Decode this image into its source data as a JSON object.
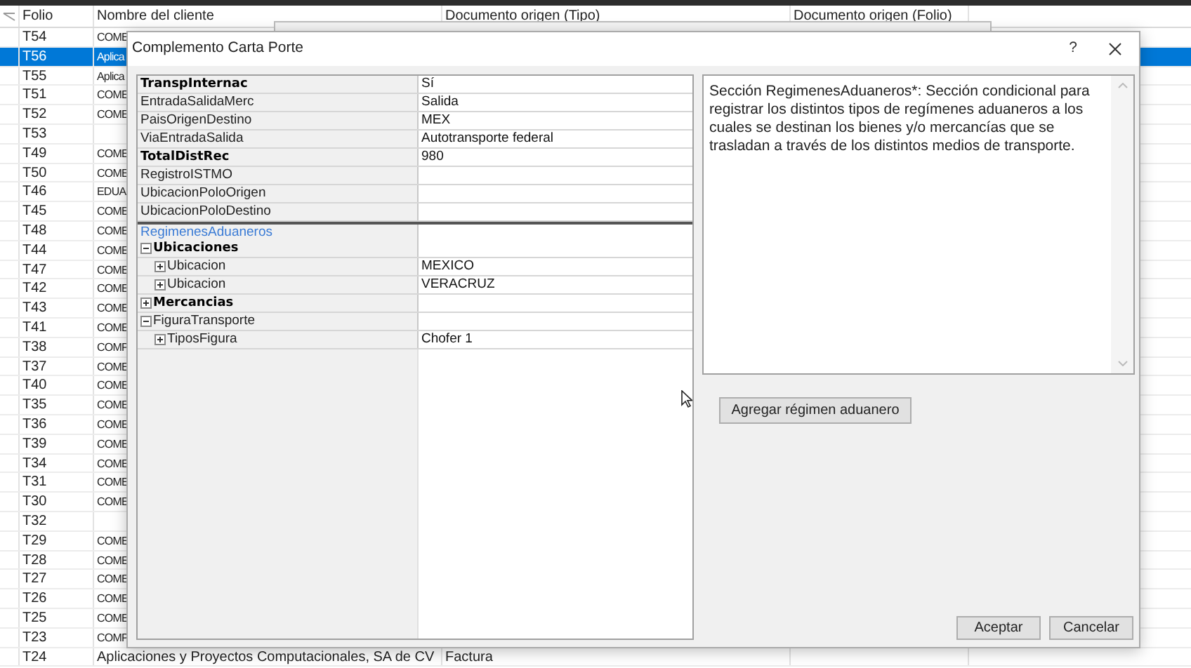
{
  "table": {
    "columns": [
      "Folio",
      "Nombre del cliente",
      "Documento origen (Tipo)",
      "Documento origen (Folio)"
    ],
    "rows": [
      {
        "folio": "T54",
        "cliente": "COME",
        "selected": false
      },
      {
        "folio": "T56",
        "cliente": "Aplica",
        "selected": true
      },
      {
        "folio": "T55",
        "cliente": "Aplica",
        "selected": false
      },
      {
        "folio": "T51",
        "cliente": "COME",
        "selected": false
      },
      {
        "folio": "T52",
        "cliente": "COME",
        "selected": false
      },
      {
        "folio": "T53",
        "selected": false
      },
      {
        "folio": "T49",
        "cliente": "COME",
        "selected": false
      },
      {
        "folio": "T50",
        "cliente": "COME",
        "selected": false
      },
      {
        "folio": "T46",
        "cliente": "EDUA",
        "selected": false
      },
      {
        "folio": "T45",
        "cliente": "COME",
        "selected": false
      },
      {
        "folio": "T48",
        "cliente": "COME",
        "selected": false
      },
      {
        "folio": "T44",
        "cliente": "COME",
        "selected": false
      },
      {
        "folio": "T47",
        "cliente": "COME",
        "selected": false
      },
      {
        "folio": "T42",
        "cliente": "COME",
        "selected": false
      },
      {
        "folio": "T43",
        "cliente": "COME",
        "selected": false
      },
      {
        "folio": "T41",
        "cliente": "COME",
        "selected": false
      },
      {
        "folio": "T38",
        "cliente": "COMP",
        "selected": false
      },
      {
        "folio": "T37",
        "cliente": "COME",
        "selected": false
      },
      {
        "folio": "T40",
        "cliente": "COME",
        "selected": false
      },
      {
        "folio": "T35",
        "cliente": "COME",
        "selected": false
      },
      {
        "folio": "T36",
        "cliente": "COME",
        "selected": false
      },
      {
        "folio": "T39",
        "cliente": "COME",
        "selected": false
      },
      {
        "folio": "T34",
        "cliente": "COME",
        "selected": false
      },
      {
        "folio": "T31",
        "cliente": "COME",
        "selected": false
      },
      {
        "folio": "T30",
        "cliente": "COME",
        "selected": false
      },
      {
        "folio": "T32",
        "selected": false
      },
      {
        "folio": "T29",
        "cliente": "COME",
        "selected": false
      },
      {
        "folio": "T28",
        "cliente": "COME",
        "selected": false
      },
      {
        "folio": "T27",
        "cliente": "COME",
        "selected": false
      },
      {
        "folio": "T26",
        "cliente": "COME",
        "selected": false
      },
      {
        "folio": "T25",
        "cliente": "COME",
        "selected": false
      },
      {
        "folio": "T23",
        "cliente": "COMP",
        "selected": false
      },
      {
        "folio": "T24",
        "cliente": "Aplicaciones y Proyectos Computacionales, SA de CV",
        "tipo": "Factura",
        "selected": false
      }
    ]
  },
  "dialog": {
    "title": "Complemento Carta Porte",
    "help": "?",
    "properties": [
      {
        "name": "TranspInternac",
        "value": "Sí",
        "bold": true,
        "selected": false
      },
      {
        "name": "EntradaSalidaMerc",
        "value": "Salida",
        "bold": false,
        "selected": false
      },
      {
        "name": "PaisOrigenDestino",
        "value": "MEX",
        "bold": false,
        "selected": false
      },
      {
        "name": "ViaEntradaSalida",
        "value": "Autotransporte federal",
        "bold": false,
        "selected": false
      },
      {
        "name": "TotalDistRec",
        "value": "980",
        "bold": true,
        "selected": false
      },
      {
        "name": "RegistroISTMO",
        "bold": false,
        "selected": false
      },
      {
        "name": "UbicacionPoloOrigen",
        "bold": false,
        "selected": false
      },
      {
        "name": "UbicacionPoloDestino",
        "bold": false,
        "selected": false
      },
      {
        "name": "RegimenesAduaneros",
        "bold": false,
        "selected": true
      },
      {
        "name": "Ubicaciones",
        "bold": true,
        "selected": false,
        "expanded": true,
        "children": [
          {
            "name": "Ubicacion",
            "value": "MEXICO",
            "bold": false,
            "selected": false,
            "expanded": false
          },
          {
            "name": "Ubicacion",
            "value": "VERACRUZ",
            "bold": false,
            "selected": false,
            "expanded": false
          }
        ]
      },
      {
        "name": "Mercancias",
        "bold": true,
        "selected": false,
        "expanded": false
      },
      {
        "name": "FiguraTransporte",
        "bold": false,
        "selected": false,
        "expanded": true,
        "children": [
          {
            "name": "TiposFigura",
            "value": "Chofer 1",
            "bold": false,
            "selected": false,
            "expanded": false
          }
        ]
      }
    ],
    "description": "Sección RegimenesAduaneros*: Sección condicional para registrar los distintos tipos de regímenes aduaneros a los cuales se destinan los bienes y/o mercancías que se trasladan a través de los distintos medios de transporte.",
    "add_button": "Agregar régimen aduanero",
    "buttons": [
      "Aceptar",
      "Cancelar"
    ]
  }
}
